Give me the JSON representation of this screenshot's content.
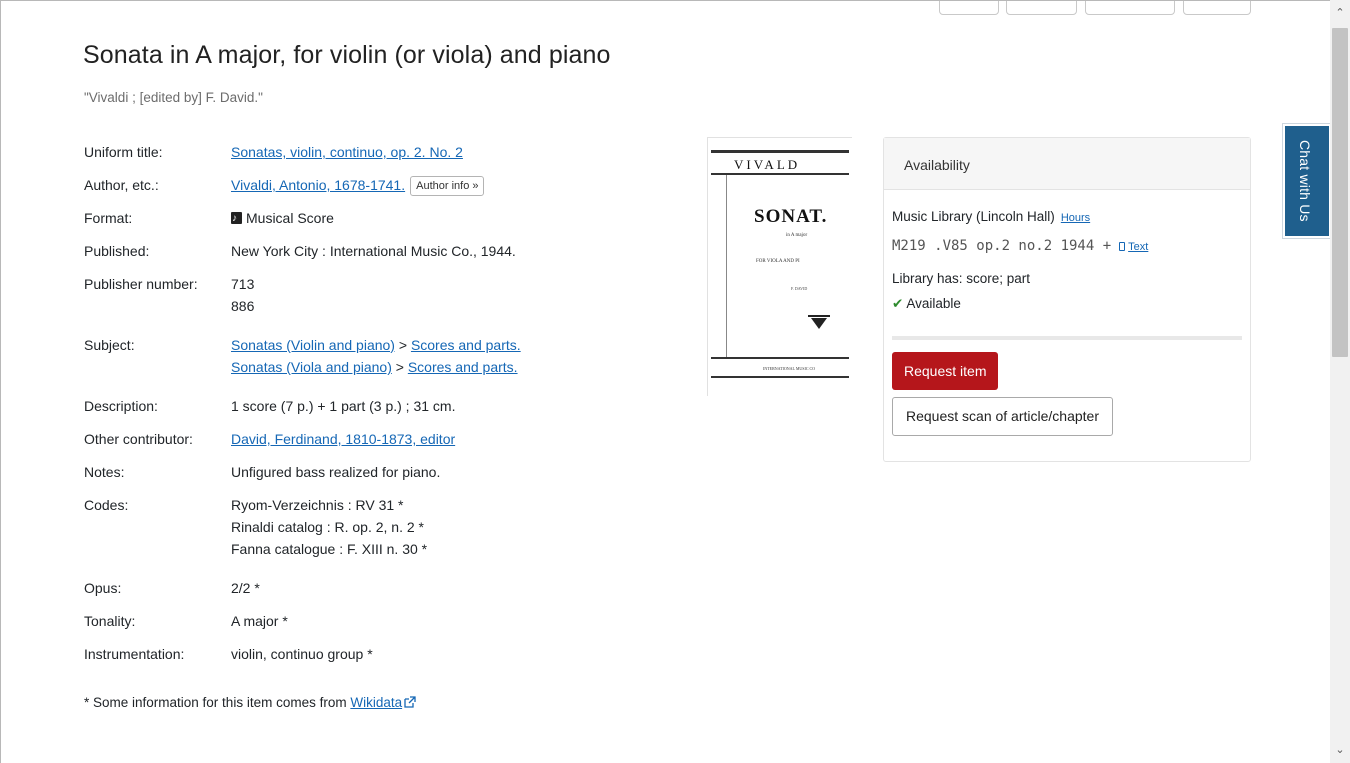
{
  "title": "Sonata in A major, for violin (or viola) and piano",
  "responsibility": "\"Vivaldi ; [edited by] F. David.\"",
  "fields": [
    {
      "label": "Uniform title:",
      "values": [
        {
          "link": "Sonatas, violin, continuo, op. 2. No. 2"
        }
      ]
    },
    {
      "label": "Author, etc.:",
      "values": [
        {
          "link": "Vivaldi, Antonio, 1678-1741.",
          "button": "Author info »"
        }
      ]
    },
    {
      "label": "Format:",
      "values": [
        {
          "icon": "musical-score-icon",
          "text": "Musical Score"
        }
      ]
    },
    {
      "label": "Published:",
      "values": [
        {
          "text": "New York City : International Music Co., 1944."
        }
      ]
    },
    {
      "label": "Publisher number:",
      "values": [
        {
          "text": "713"
        },
        {
          "text": "886"
        }
      ]
    },
    {
      "label": "Subject:",
      "values": [
        {
          "link": "Sonatas (Violin and piano)",
          "sep": " > ",
          "link2": "Scores and parts."
        },
        {
          "link": "Sonatas (Viola and piano)",
          "sep": " > ",
          "link2": "Scores and parts."
        }
      ]
    },
    {
      "label": "Description:",
      "values": [
        {
          "text": "1 score (7 p.) + 1 part (3 p.) ; 31 cm."
        }
      ]
    },
    {
      "label": "Other contributor:",
      "values": [
        {
          "link": "David, Ferdinand, 1810-1873, editor"
        }
      ]
    },
    {
      "label": "Notes:",
      "values": [
        {
          "text": "Unfigured bass realized for piano."
        }
      ]
    },
    {
      "label": "Codes:",
      "values": [
        {
          "text": "Ryom-Verzeichnis : RV 31 *"
        },
        {
          "text": "Rinaldi catalog : R. op. 2, n. 2 *"
        },
        {
          "text": "Fanna catalogue : F. XIII n. 30 *"
        }
      ]
    },
    {
      "label": "Opus:",
      "values": [
        {
          "text": "2/2 *"
        }
      ]
    },
    {
      "label": "Tonality:",
      "values": [
        {
          "text": "A major *"
        }
      ]
    },
    {
      "label": "Instrumentation:",
      "values": [
        {
          "text": "violin, continuo group *"
        }
      ]
    }
  ],
  "wikidata_note": {
    "text": "* Some information for this item comes from ",
    "link": "Wikidata"
  },
  "cover": {
    "line1": "VIVALD",
    "line2": "SONAT.",
    "line3": "in A major",
    "line4": "FOR VIOLA AND PI",
    "line5": "F. DAVID",
    "line6": "INTERNATIONAL MUSIC CO"
  },
  "availability": {
    "header": "Availability",
    "library": "Music Library (Lincoln Hall)",
    "hours_link": "Hours",
    "call_number": "M219 .V85 op.2 no.2 1944 +",
    "text_link": "Text",
    "library_has": "Library has: score; part",
    "status": "Available",
    "request_button": "Request item",
    "scan_button": "Request scan of article/chapter"
  },
  "chat_widget": "Chat with Us",
  "colors": {
    "link": "#1567b5",
    "request": "#b5161b",
    "chat": "#1f5f8d",
    "available": "#2e8b2e"
  }
}
